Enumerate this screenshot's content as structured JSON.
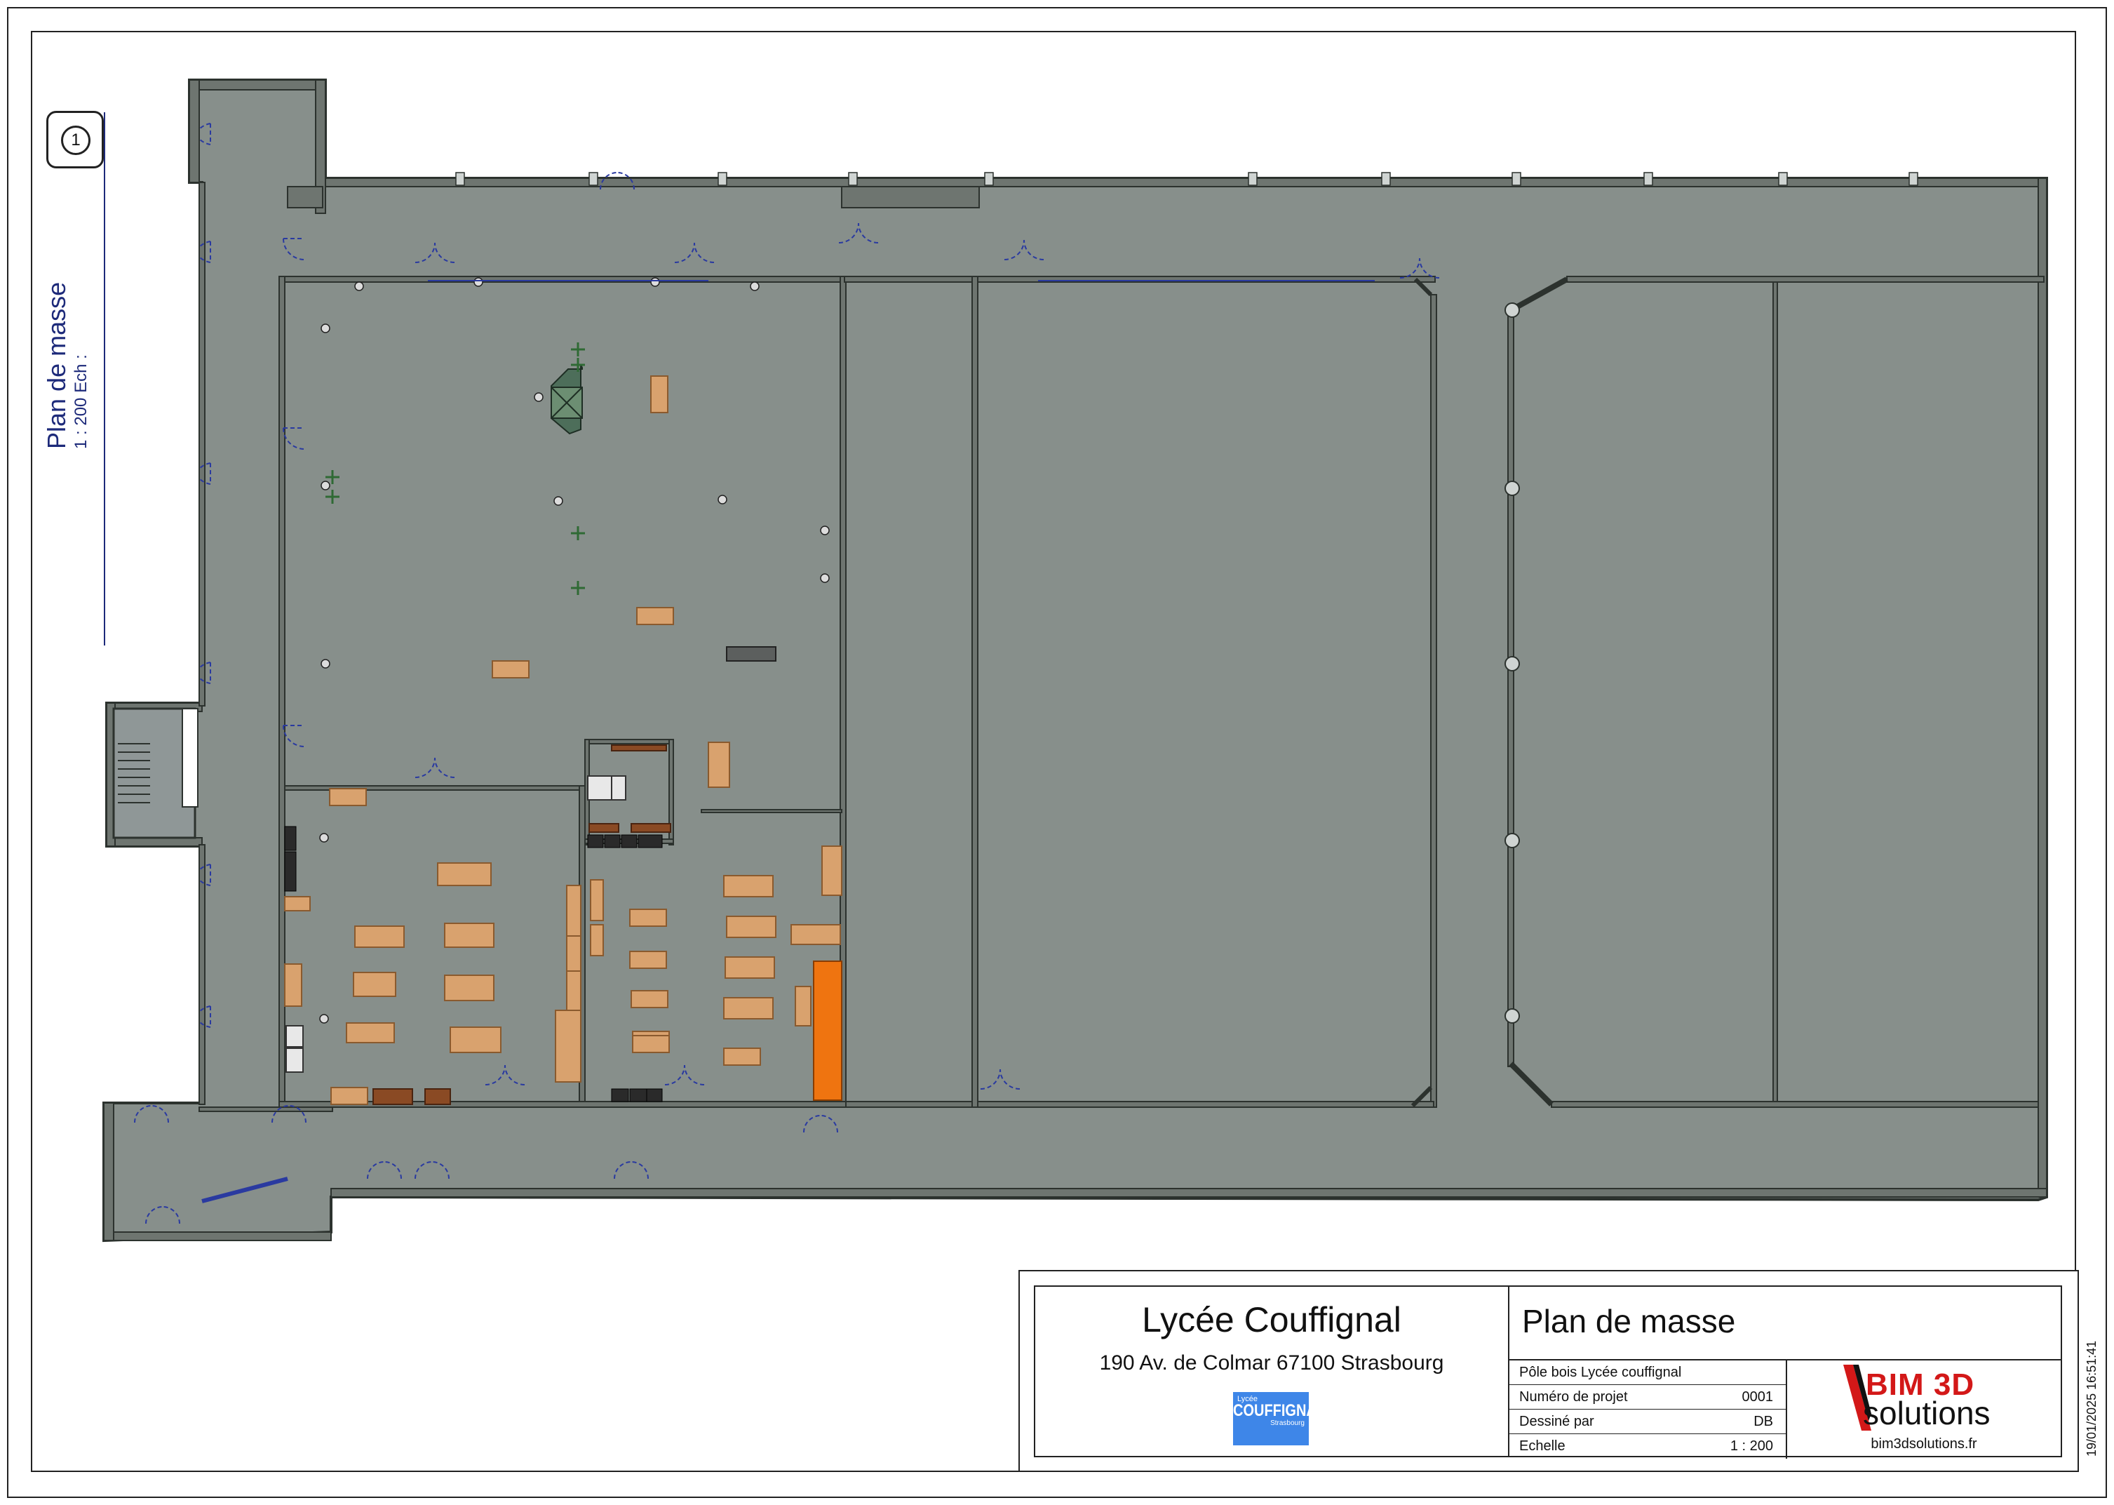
{
  "view": {
    "name": "Plan de masse",
    "scale_label": "1 : 200",
    "scale_prefix": "Ech :",
    "number": "1"
  },
  "title_block": {
    "school": "Lycée Couffignal",
    "address": "190 Av. de Colmar 67100 Strasbourg",
    "logo": {
      "line1": "Lycée",
      "line2": "COUFFIGNAL",
      "line3": "Strasbourg",
      "color": "#3e86e8"
    },
    "sheet_title": "Plan de masse",
    "rows": [
      {
        "key": "Pôle bois Lycée couffignal",
        "value": ""
      },
      {
        "key": "Numéro de projet",
        "value": "0001"
      },
      {
        "key": "Dessiné par",
        "value": "DB"
      },
      {
        "key": "Echelle",
        "value": "1 : 200"
      }
    ],
    "brand": {
      "bim": "BIM 3D",
      "solutions": "solutions",
      "url": "bim3dsolutions.fr",
      "accent": "#d31818"
    }
  },
  "timestamp": "19/01/2025 16:51:41",
  "colors": {
    "floor": "#878f8b",
    "floor_light": "#8e9696",
    "wall": "#6e7570",
    "wall_edge": "#2c322e",
    "furniture": "#d9a26e",
    "furniture_edge": "#8a5a2e",
    "highlight": "#ef7410",
    "dark_furniture": "#2a2a2a",
    "door": "#2a3aa0"
  }
}
